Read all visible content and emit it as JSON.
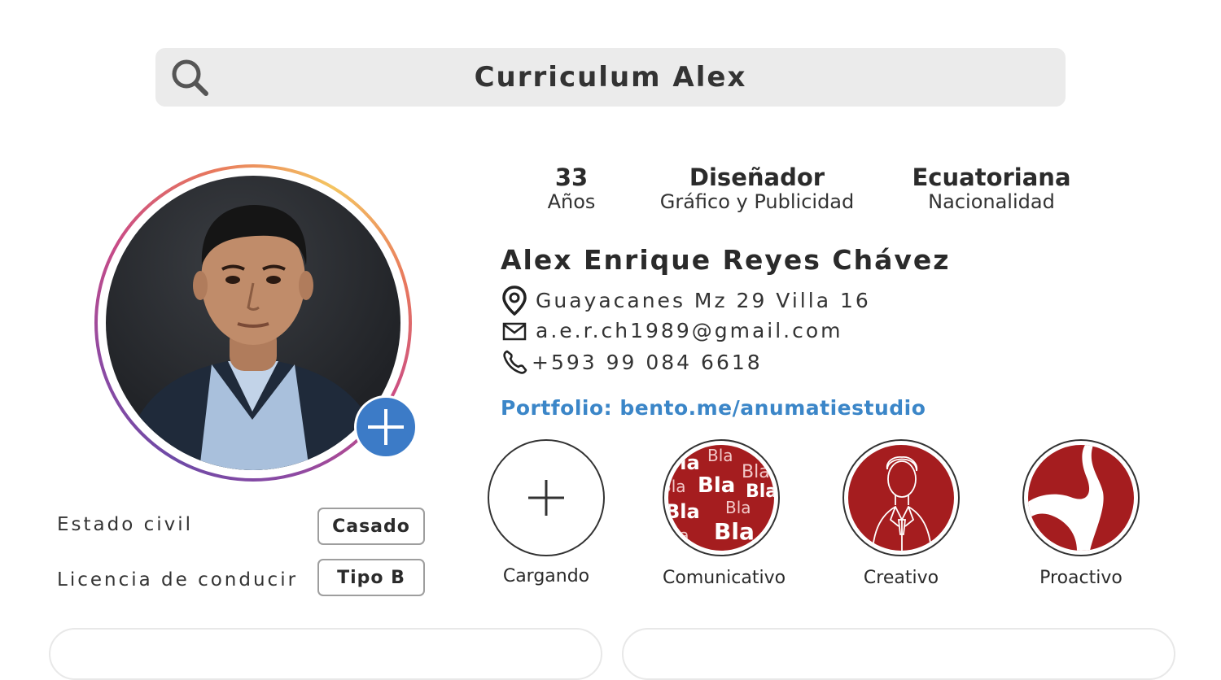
{
  "search": {
    "title": "Curriculum Alex"
  },
  "stats": [
    {
      "value": "33",
      "caption": "Años"
    },
    {
      "value": "Diseñador",
      "caption": "Gráfico y Publicidad"
    },
    {
      "value": "Ecuatoriana",
      "caption": "Nacionalidad"
    }
  ],
  "profile": {
    "name": "Alex Enrique Reyes Chávez",
    "address": "Guayacanes Mz 29 Villa 16",
    "email": "a.e.r.ch1989@gmail.com",
    "phone": "+593 99 084 6618",
    "portfolio": "Portfolio: bento.me/anumatiestudio"
  },
  "highlights": [
    {
      "label": "Cargando",
      "icon": "plus-icon"
    },
    {
      "label": "Comunicativo",
      "icon": "bla-bla-icon",
      "bla_text": "Bla"
    },
    {
      "label": "Creativo",
      "icon": "person-sketch-icon"
    },
    {
      "label": "Proactivo",
      "icon": "abstract-shape-icon"
    }
  ],
  "details": [
    {
      "label": "Estado civil",
      "value": "Casado"
    },
    {
      "label": "Licencia de conducir",
      "value": "Tipo B"
    }
  ],
  "colors": {
    "accent_blue": "#3c7bc7",
    "link_blue": "#3b86c8",
    "highlight_red": "#a51d1f",
    "search_bg": "#ebebeb"
  }
}
